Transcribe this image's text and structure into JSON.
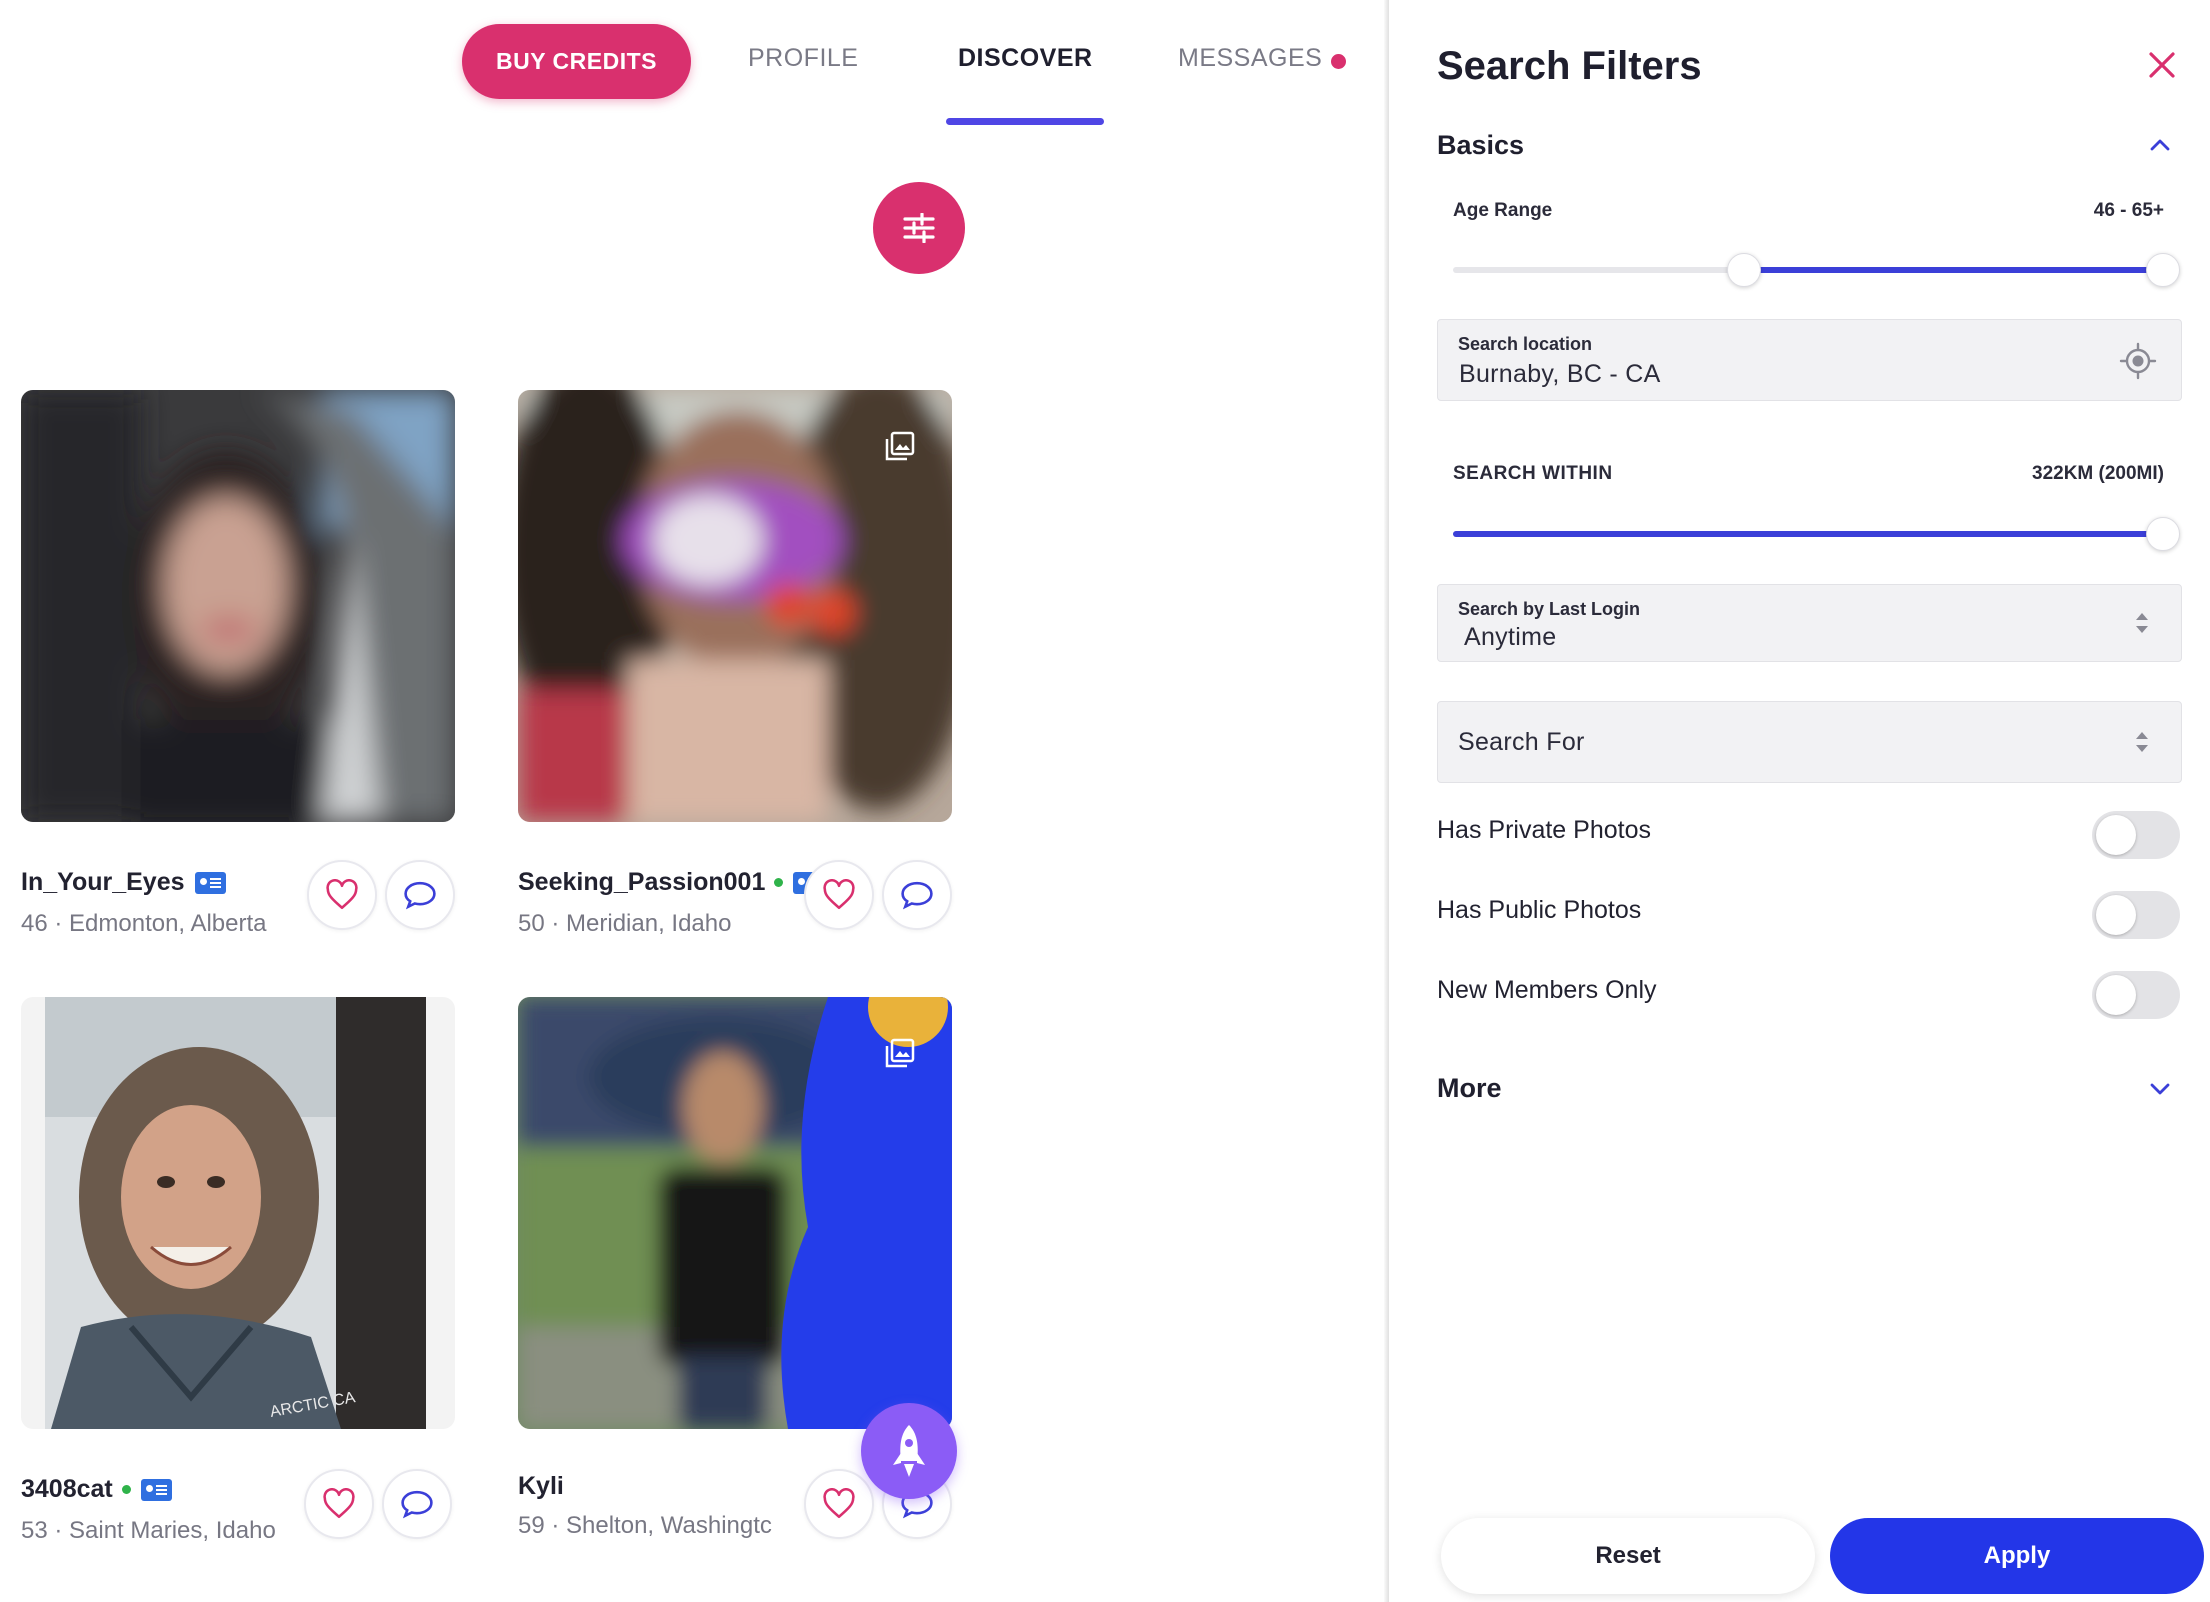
{
  "nav": {
    "buy_credits": "BUY CREDITS",
    "profile": "PROFILE",
    "discover": "DISCOVER",
    "messages": "MESSAGES"
  },
  "profiles": [
    {
      "username": "In_Your_Eyes",
      "meta": "46 · Edmonton, Alberta",
      "online": false,
      "verified": true,
      "photo_gallery": false
    },
    {
      "username": "Seeking_Passion001",
      "meta": "50 · Meridian, Idaho",
      "online": true,
      "verified": true,
      "photo_gallery": true
    },
    {
      "username": "3408cat",
      "meta": "53 · Saint Maries, Idaho",
      "online": true,
      "verified": true,
      "photo_gallery": false
    },
    {
      "username": "Kyli",
      "meta": "59 · Shelton, Washingtc",
      "online": false,
      "verified": false,
      "photo_gallery": true
    }
  ],
  "filters": {
    "title": "Search Filters",
    "basics": "Basics",
    "age_range": {
      "label": "Age Range",
      "value": "46 - 65+",
      "min_fraction": 0.41,
      "max_fraction": 1.0
    },
    "search_location": {
      "label": "Search location",
      "value": "Burnaby, BC - CA"
    },
    "search_within": {
      "label": "SEARCH WITHIN",
      "value": "322KM (200MI)",
      "fraction": 1.0
    },
    "last_login": {
      "label": "Search by Last Login",
      "value": "Anytime"
    },
    "search_for": {
      "placeholder": "Search For"
    },
    "toggles": [
      {
        "label": "Has Private Photos",
        "on": false
      },
      {
        "label": "Has Public Photos",
        "on": false
      },
      {
        "label": "New Members Only",
        "on": false
      }
    ],
    "more": "More",
    "reset": "Reset",
    "apply": "Apply"
  },
  "colors": {
    "brand_pink": "#d9306e",
    "accent_blue": "#2336e8",
    "slider_blue": "#3b3fd8",
    "rocket_purple": "#8b5cf6",
    "online_green": "#2fb34a"
  }
}
